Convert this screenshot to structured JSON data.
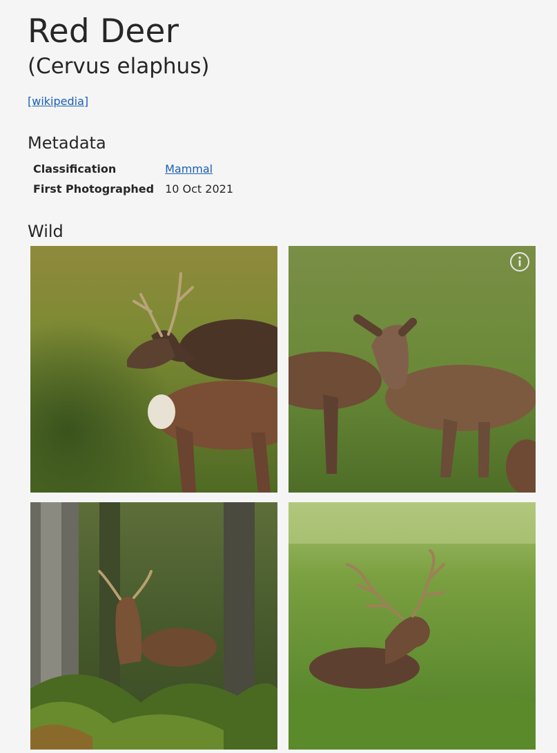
{
  "page": {
    "title": "Red Deer",
    "scientific_name": "(Cervus elaphus)",
    "wikipedia_link": "[wikipedia]"
  },
  "metadata": {
    "heading": "Metadata",
    "rows": [
      {
        "key": "Classification",
        "value": "Mammal",
        "is_link": true
      },
      {
        "key": "First Photographed",
        "value": "10 Oct 2021",
        "is_link": false
      }
    ]
  },
  "sections": [
    {
      "heading": "Wild",
      "photos": [
        {
          "subject": "red deer stag and hind in grass"
        },
        {
          "subject": "young deer looking at camera",
          "info_icon": "info-icon"
        },
        {
          "subject": "stag among trees and ferns"
        },
        {
          "subject": "antlered stag lying in grass"
        }
      ]
    }
  ],
  "colors": {
    "link": "#1a5fb4",
    "background": "#f5f5f5",
    "text": "#262626"
  }
}
